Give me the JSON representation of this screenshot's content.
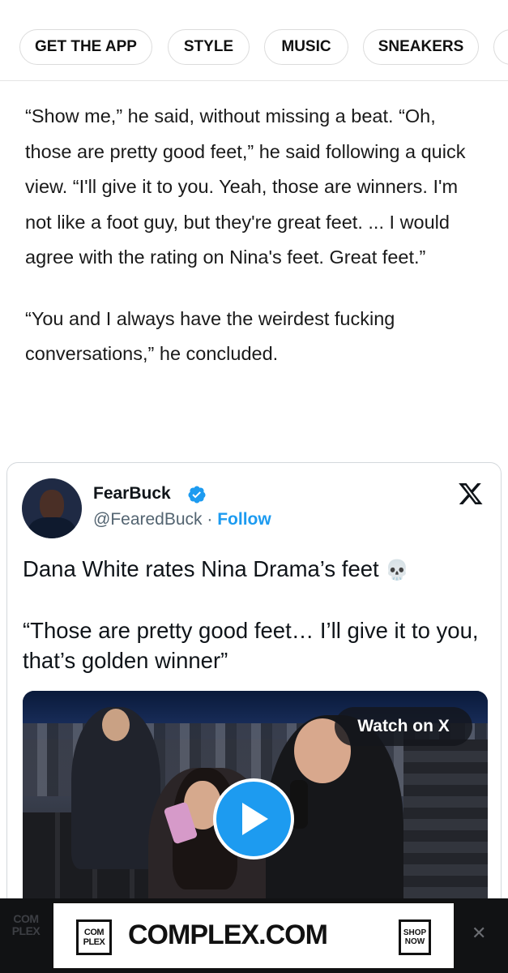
{
  "nav": {
    "pills": [
      "GET THE APP",
      "STYLE",
      "MUSIC",
      "SNEAKERS",
      ""
    ]
  },
  "article": {
    "paragraphs": [
      "“Show me,” he said, without missing a beat. “Oh, those are pretty good feet,” he said following a quick view. “I'll give it to you. Yeah, those are winners. I'm not like a foot guy, but they're great feet. ... I would agree with the rating on Nina's feet. Great feet.”",
      "“You and I always have the weirdest fucking conversations,” he concluded."
    ]
  },
  "tweet": {
    "name": "FearBuck",
    "handle": "@FearedBuck",
    "separator": "·",
    "follow_label": "Follow",
    "line1": "Dana White rates Nina Drama’s feet",
    "emoji": "💀",
    "line2": "“Those are pretty good feet… I’ll give it to you, that’s golden winner”",
    "video": {
      "watch_label": "Watch on X"
    },
    "icons": {
      "verified": "verified-badge-icon",
      "platform": "x-logo-icon",
      "play": "play-icon"
    },
    "colors": {
      "accent": "#1d9bf0",
      "secondary_text": "#536471"
    }
  },
  "ad": {
    "side_text": "COM PLEX",
    "logo_text": "COM PLEX",
    "main_text": "COMPLEX.COM",
    "shop_text": "SHOP NOW",
    "close_glyph": "✕"
  }
}
